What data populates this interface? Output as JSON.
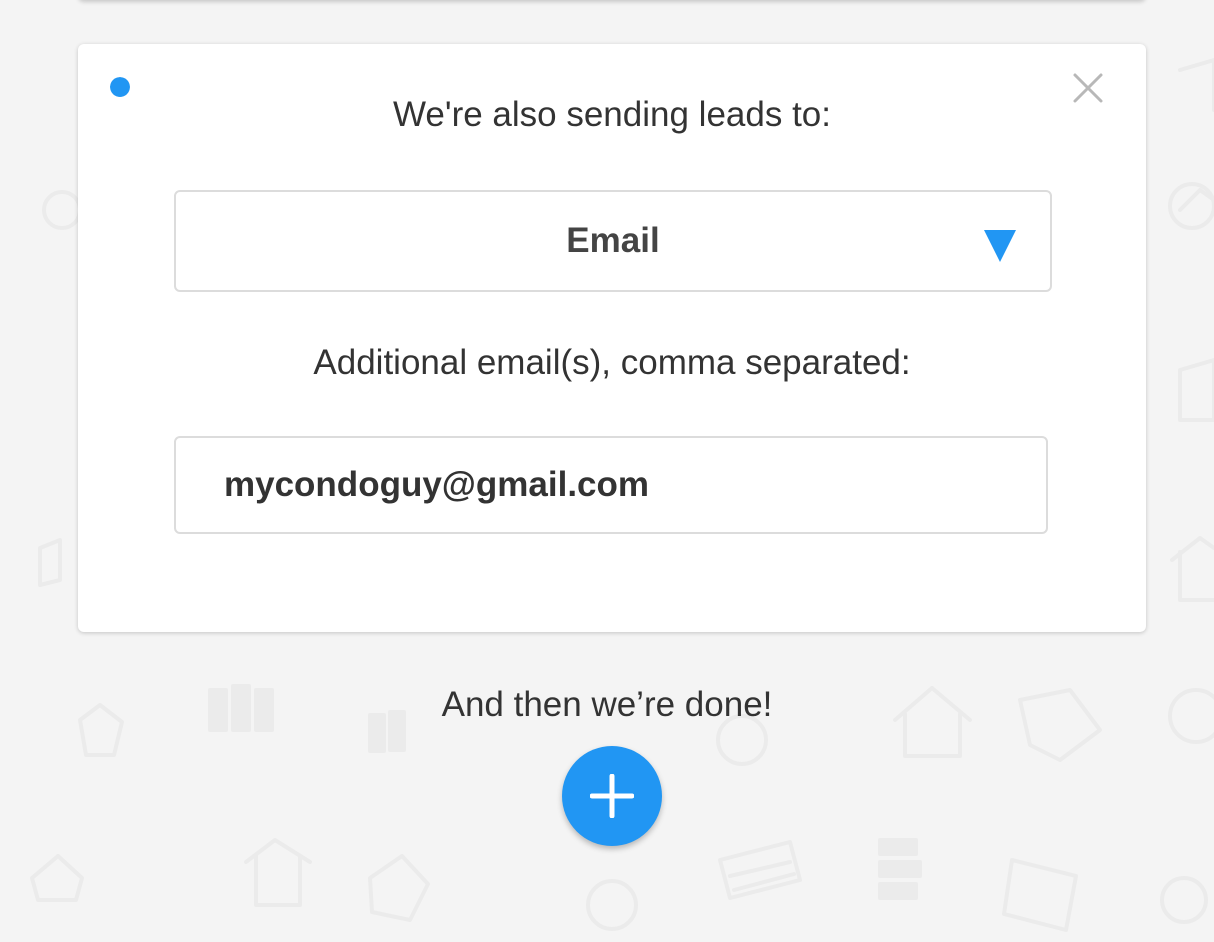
{
  "colors": {
    "accent": "#2196f3",
    "background": "#f4f4f4",
    "card": "#ffffff",
    "text": "#333333",
    "border": "#dcdcdc",
    "close_icon": "#b8b8b8"
  },
  "card": {
    "status_icon": "dot-icon",
    "close_icon": "close-icon",
    "title": "We're also sending leads to:",
    "lead_destination": {
      "selected": "Email",
      "icon": "triangle-down-icon"
    },
    "emails_label": "Additional email(s), comma separated:",
    "emails_value": "mycondoguy@gmail.com"
  },
  "footer": {
    "done_text": "And then we’re done!",
    "add_icon": "plus-icon"
  }
}
